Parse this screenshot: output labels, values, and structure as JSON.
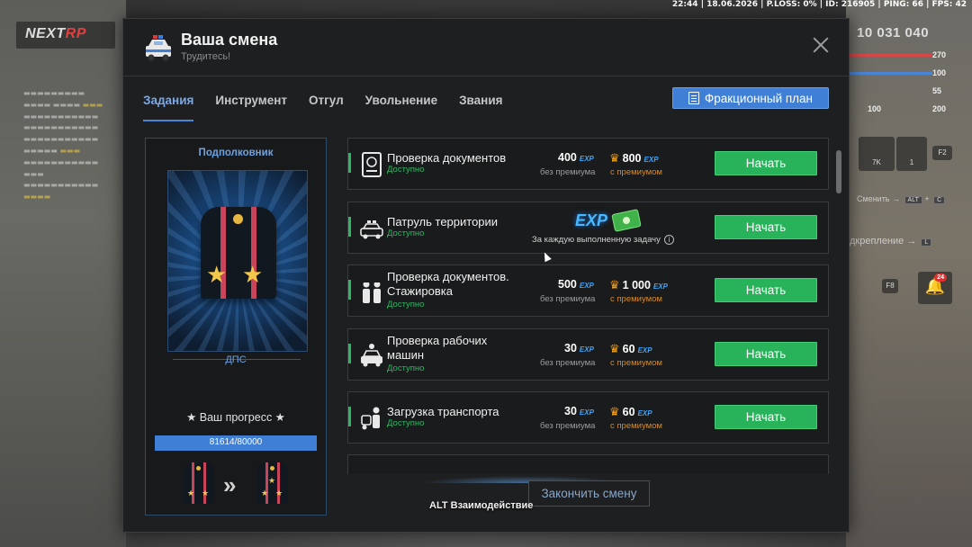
{
  "status_bar": "22:44 | 18.06.2026 | P.LOSS: 0% | ID: 216905 | PING: 66 | FPS: 42",
  "logo": {
    "part1": "NEXT",
    "part2": "RP"
  },
  "hud": {
    "money": "10 031 040",
    "stat_270": "270",
    "stat_100a": "100",
    "stat_55": "55",
    "stat_100b": "100",
    "stat_200": "200",
    "cash_7k": "7K",
    "cash_1": "1",
    "key_f2": "F2",
    "change_label": "Сменить",
    "key_alt": "ALT",
    "key_c": "C",
    "backup_label": "дкрепление",
    "key_l": "L",
    "key_f8": "F8",
    "bell_count": "24"
  },
  "panel": {
    "title": "Ваша смена",
    "subtitle": "Трудитесь!",
    "tabs": [
      "Задания",
      "Инструмент",
      "Отгул",
      "Увольнение",
      "Звания"
    ],
    "plan_button": "Фракционный план",
    "finish_button": "Закончить смену"
  },
  "rank": {
    "title": "Подполковник",
    "department": "ДПС",
    "progress_label": "★ Ваш прогресс ★",
    "progress_text": "81614/80000",
    "progress_fraction": 1.0
  },
  "tasks": [
    {
      "name": "Проверка документов",
      "status": "Доступно",
      "exp_base": "400",
      "exp_prem": "800",
      "label_base": "без премиума",
      "label_prem": "с премиумом",
      "button": "Начать"
    },
    {
      "name": "Патруль территории",
      "status": "Доступно",
      "exp_tag": "EXP",
      "note": "За каждую выполненную задачу",
      "button": "Начать"
    },
    {
      "name": "Проверка документов. Стажировка",
      "status": "Доступно",
      "exp_base": "500",
      "exp_prem": "1 000",
      "label_base": "без премиума",
      "label_prem": "с премиумом",
      "button": "Начать"
    },
    {
      "name": "Проверка рабочих машин",
      "status": "Доступно",
      "exp_base": "30",
      "exp_prem": "60",
      "label_base": "без премиума",
      "label_prem": "с премиумом",
      "button": "Начать"
    },
    {
      "name": "Загрузка транспорта",
      "status": "Доступно",
      "exp_base": "30",
      "exp_prem": "60",
      "label_base": "без премиума",
      "label_prem": "с премиумом",
      "button": "Начать"
    }
  ],
  "exp_label": "EXP",
  "alt_hint": "ALT Взаимодействие"
}
